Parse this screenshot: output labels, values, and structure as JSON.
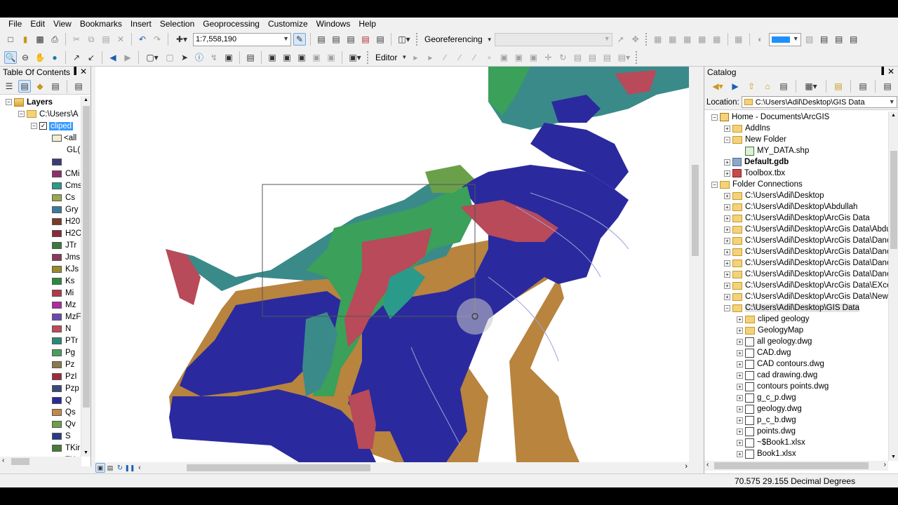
{
  "menu": [
    "File",
    "Edit",
    "View",
    "Bookmarks",
    "Insert",
    "Selection",
    "Geoprocessing",
    "Customize",
    "Windows",
    "Help"
  ],
  "toolbar": {
    "scale": "1:7,558,190",
    "georeferencing": "Georeferencing",
    "editor": "Editor"
  },
  "toc": {
    "title": "Table Of Contents",
    "pin": "▐",
    "close": "✕",
    "layers_label": "Layers",
    "folder_label": "C:\\Users\\A",
    "layer_label": "cliped",
    "all_label": "<all",
    "field_label": "GL(",
    "legend": [
      {
        "label": "",
        "color": "#3b3b7a"
      },
      {
        "label": "CMi",
        "color": "#8c2f6c"
      },
      {
        "label": "Cms",
        "color": "#2a9a8a"
      },
      {
        "label": "Cs",
        "color": "#9aa84a"
      },
      {
        "label": "Gry",
        "color": "#3a7aa0"
      },
      {
        "label": "H20",
        "color": "#7a3a2a"
      },
      {
        "label": "H2C",
        "color": "#8a2a3a"
      },
      {
        "label": "JTr",
        "color": "#3a7a3a"
      },
      {
        "label": "Jms",
        "color": "#8a3a5a"
      },
      {
        "label": "KJs",
        "color": "#9a8a2a"
      },
      {
        "label": "Ks",
        "color": "#2a8a3a"
      },
      {
        "label": "Mi",
        "color": "#b03a4a"
      },
      {
        "label": "Mz",
        "color": "#b02aa0"
      },
      {
        "label": "MzF",
        "color": "#6a4ab0"
      },
      {
        "label": "N",
        "color": "#c04a5a"
      },
      {
        "label": "PTr",
        "color": "#2a8a7a"
      },
      {
        "label": "Pg",
        "color": "#4aa05a"
      },
      {
        "label": "Pz",
        "color": "#8a7a4a"
      },
      {
        "label": "PzI",
        "color": "#a02a3a"
      },
      {
        "label": "Pzp",
        "color": "#3a4a7a"
      },
      {
        "label": "Q",
        "color": "#2a2aa0"
      },
      {
        "label": "Qs",
        "color": "#c08a4a"
      },
      {
        "label": "Qv",
        "color": "#6aa04a"
      },
      {
        "label": "S",
        "color": "#2a3a8a"
      },
      {
        "label": "TKir",
        "color": "#4a7a3a"
      },
      {
        "label": "TKr",
        "color": "#8a3aa0"
      }
    ]
  },
  "catalog": {
    "title": "Catalog",
    "pin": "▐",
    "close": "✕",
    "location_label": "Location:",
    "location_value": "C:\\Users\\Adil\\Desktop\\GIS Data",
    "tree": [
      {
        "label": "Home - Documents\\ArcGIS",
        "indent": 0,
        "exp": "−",
        "icon": "home",
        "bold": false
      },
      {
        "label": "AddIns",
        "indent": 1,
        "exp": "+",
        "icon": "folder",
        "bold": false
      },
      {
        "label": "New Folder",
        "indent": 1,
        "exp": "−",
        "icon": "folder",
        "bold": false
      },
      {
        "label": "MY_DATA.shp",
        "indent": 2,
        "exp": "",
        "icon": "shp",
        "bold": false
      },
      {
        "label": "Default.gdb",
        "indent": 1,
        "exp": "+",
        "icon": "gdb",
        "bold": true
      },
      {
        "label": "Toolbox.tbx",
        "indent": 1,
        "exp": "+",
        "icon": "tbx",
        "bold": false
      },
      {
        "label": "Folder Connections",
        "indent": 0,
        "exp": "−",
        "icon": "folder",
        "bold": false
      },
      {
        "label": "C:\\Users\\Adil\\Desktop",
        "indent": 1,
        "exp": "+",
        "icon": "folder",
        "bold": false
      },
      {
        "label": "C:\\Users\\Adil\\Desktop\\Abdullah",
        "indent": 1,
        "exp": "+",
        "icon": "folder",
        "bold": false
      },
      {
        "label": "C:\\Users\\Adil\\Desktop\\ArcGis Data",
        "indent": 1,
        "exp": "+",
        "icon": "folder",
        "bold": false
      },
      {
        "label": "C:\\Users\\Adil\\Desktop\\ArcGis Data\\Abdu",
        "indent": 1,
        "exp": "+",
        "icon": "folder",
        "bold": false
      },
      {
        "label": "C:\\Users\\Adil\\Desktop\\ArcGis Data\\Danc",
        "indent": 1,
        "exp": "+",
        "icon": "folder",
        "bold": false
      },
      {
        "label": "C:\\Users\\Adil\\Desktop\\ArcGis Data\\Danc",
        "indent": 1,
        "exp": "+",
        "icon": "folder",
        "bold": false
      },
      {
        "label": "C:\\Users\\Adil\\Desktop\\ArcGis Data\\Danc",
        "indent": 1,
        "exp": "+",
        "icon": "folder",
        "bold": false
      },
      {
        "label": "C:\\Users\\Adil\\Desktop\\ArcGis Data\\Danc",
        "indent": 1,
        "exp": "+",
        "icon": "folder",
        "bold": false
      },
      {
        "label": "C:\\Users\\Adil\\Desktop\\ArcGis Data\\EXce",
        "indent": 1,
        "exp": "+",
        "icon": "folder",
        "bold": false
      },
      {
        "label": "C:\\Users\\Adil\\Desktop\\ArcGis Data\\New",
        "indent": 1,
        "exp": "+",
        "icon": "folder",
        "bold": false
      },
      {
        "label": "C:\\Users\\Adil\\Desktop\\GIS Data",
        "indent": 1,
        "exp": "−",
        "icon": "folder",
        "bold": false
      },
      {
        "label": "cliped geology",
        "indent": 2,
        "exp": "+",
        "icon": "folder",
        "bold": false
      },
      {
        "label": "GeologyMap",
        "indent": 2,
        "exp": "+",
        "icon": "folder",
        "bold": false
      },
      {
        "label": "all geology.dwg",
        "indent": 2,
        "exp": "+",
        "icon": "dwg",
        "bold": false
      },
      {
        "label": "CAD.dwg",
        "indent": 2,
        "exp": "+",
        "icon": "dwg",
        "bold": false
      },
      {
        "label": "CAD contours.dwg",
        "indent": 2,
        "exp": "+",
        "icon": "dwg",
        "bold": false
      },
      {
        "label": "cad drawing.dwg",
        "indent": 2,
        "exp": "+",
        "icon": "dwg",
        "bold": false
      },
      {
        "label": "contours points.dwg",
        "indent": 2,
        "exp": "+",
        "icon": "dwg",
        "bold": false
      },
      {
        "label": "g_c_p.dwg",
        "indent": 2,
        "exp": "+",
        "icon": "dwg",
        "bold": false
      },
      {
        "label": "geology.dwg",
        "indent": 2,
        "exp": "+",
        "icon": "dwg",
        "bold": false
      },
      {
        "label": "p_c_b.dwg",
        "indent": 2,
        "exp": "+",
        "icon": "dwg",
        "bold": false
      },
      {
        "label": "points.dwg",
        "indent": 2,
        "exp": "+",
        "icon": "dwg",
        "bold": false
      },
      {
        "label": "~$Book1.xlsx",
        "indent": 2,
        "exp": "+",
        "icon": "xls",
        "bold": false
      },
      {
        "label": "Book1.xlsx",
        "indent": 2,
        "exp": "+",
        "icon": "xls",
        "bold": false
      }
    ]
  },
  "status": {
    "coords": "70.575  29.155 Decimal Degrees"
  },
  "colors": {
    "map_blue": "#2a2a9e",
    "map_tan": "#b8843e",
    "map_teal": "#3a8a8a",
    "map_red": "#b84a5a",
    "map_green": "#3aa05a",
    "selection_blue": "#3399ff"
  }
}
